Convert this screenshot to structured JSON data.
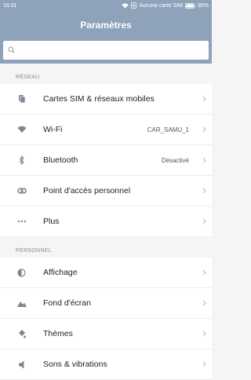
{
  "status": {
    "time": "16:31",
    "carrier": "Aucune carte SIM",
    "battery": "95%"
  },
  "header": {
    "title": "Paramètres"
  },
  "search": {
    "placeholder": ""
  },
  "sections": [
    {
      "label": "RÉSEAU",
      "items": [
        {
          "label": "Cartes SIM & réseaux mobiles",
          "value": "",
          "icon": "sim-card-icon"
        },
        {
          "label": "Wi-Fi",
          "value": "CAR_SAMU_1",
          "icon": "wifi-icon"
        },
        {
          "label": "Bluetooth",
          "value": "Désactivé",
          "icon": "bluetooth-icon"
        },
        {
          "label": "Point d'accès personnel",
          "value": "",
          "icon": "hotspot-icon"
        },
        {
          "label": "Plus",
          "value": "",
          "icon": "more-dots-icon"
        }
      ]
    },
    {
      "label": "PERSONNEL",
      "items": [
        {
          "label": "Affichage",
          "value": "",
          "icon": "display-icon"
        },
        {
          "label": "Fond d'écran",
          "value": "",
          "icon": "wallpaper-icon"
        },
        {
          "label": "Thèmes",
          "value": "",
          "icon": "themes-icon"
        },
        {
          "label": "Sons & vibrations",
          "value": "",
          "icon": "sound-icon"
        }
      ]
    }
  ]
}
